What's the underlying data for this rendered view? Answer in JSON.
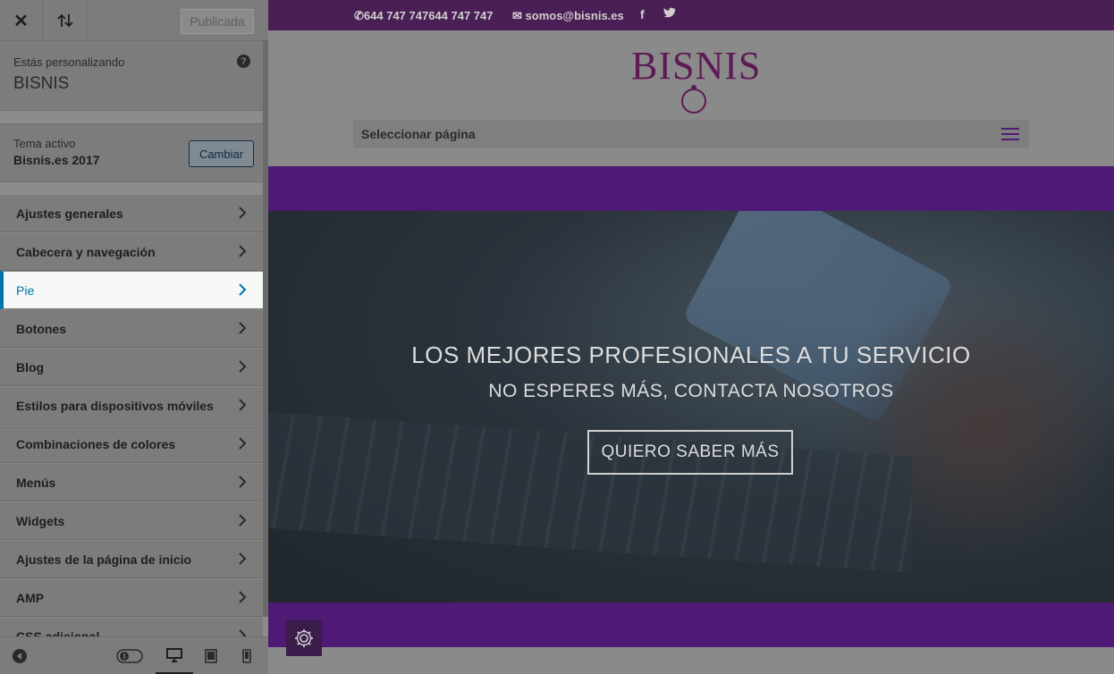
{
  "customizer": {
    "publish_label": "Publicada",
    "customizing_label": "Estás personalizando",
    "site_name": "BISNIS",
    "theme_label": "Tema activo",
    "theme_name": "Bisnis.es 2017",
    "change_label": "Cambiar",
    "panels": [
      {
        "label": "Ajustes generales"
      },
      {
        "label": "Cabecera y navegación"
      },
      {
        "label": "Pie"
      },
      {
        "label": "Botones"
      },
      {
        "label": "Blog"
      },
      {
        "label": "Estilos para dispositivos móviles"
      },
      {
        "label": "Combinaciones de colores"
      },
      {
        "label": "Menús"
      },
      {
        "label": "Widgets"
      },
      {
        "label": "Ajustes de la página de inicio"
      },
      {
        "label": "AMP"
      },
      {
        "label": "CSS adicional"
      }
    ],
    "active_panel": "Pie",
    "icons": [
      "close-icon",
      "reorder-icon",
      "help-icon",
      "chevron-right-icon",
      "collapse-icon",
      "toggle-icon",
      "desktop-icon",
      "tablet-icon",
      "mobile-icon"
    ]
  },
  "preview": {
    "phone": "644 747 747644 747 747",
    "email": "somos@bisnis.es",
    "logo": "BISNIS",
    "nav_select": "Seleccionar página",
    "hero_title": "LOS MEJORES PROFESIONALES A TU SERVICIO",
    "hero_subtitle": "NO ESPERES MÁS, CONTACTA NOSOTROS",
    "hero_button": "QUIERO SABER MÁS",
    "icons": [
      "phone-icon",
      "mail-icon",
      "facebook-icon",
      "twitter-icon",
      "hamburger-icon",
      "settings-icon"
    ]
  },
  "colors": {
    "accent_blue": "#0073aa",
    "top_bar_purple": "#4a1f55",
    "band_purple": "#4f1a76",
    "logo_purple": "#5e1a55"
  }
}
